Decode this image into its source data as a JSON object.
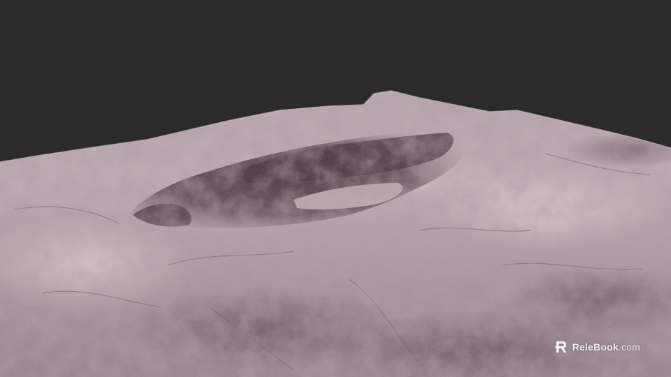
{
  "watermark": {
    "brand": "ReleBook",
    "tld": ".com",
    "logo_icon": "relebook-logo-icon"
  },
  "colors": {
    "background": "#2b2b2b",
    "rock_light": "#c6b4bb",
    "rock_mid": "#a48f98",
    "rock_dark": "#6b5760",
    "crater_shadow": "#4a3940"
  }
}
